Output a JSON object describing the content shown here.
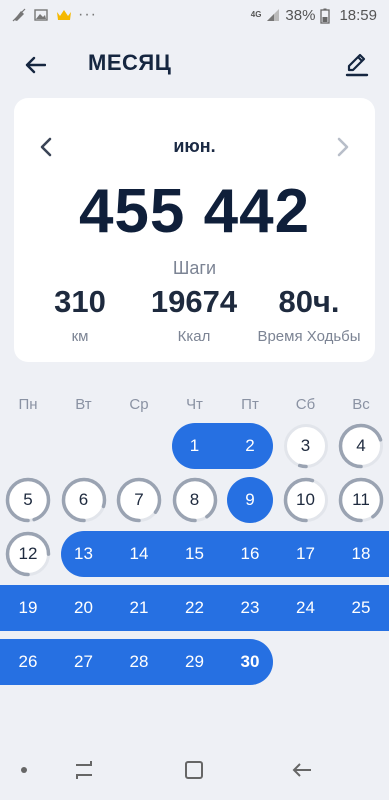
{
  "status_bar": {
    "network": "4G",
    "battery": "38%",
    "time": "18:59",
    "left_icons": [
      "mute-icon",
      "gallery-icon",
      "crown-icon",
      "more-dots-icon"
    ],
    "more": "···"
  },
  "header": {
    "title": "МЕСЯЦ",
    "back_icon": "arrow-left-icon",
    "edit_icon": "pencil-icon"
  },
  "summary": {
    "month": "июн.",
    "total_steps": "455 442",
    "steps_label": "Шаги",
    "distance_value": "310",
    "distance_label": "км",
    "calories_value": "19674",
    "calories_label": "Ккал",
    "walk_time_value": "80ч.",
    "walk_time_label": "Время Ходьбы"
  },
  "calendar": {
    "weekdays": [
      "Пн",
      "Вт",
      "Ср",
      "Чт",
      "Пт",
      "Сб",
      "Вс"
    ],
    "days": [
      {
        "d": "1",
        "goal": 1.0
      },
      {
        "d": "2",
        "goal": 1.0
      },
      {
        "d": "3",
        "goal": 0.05
      },
      {
        "d": "4",
        "goal": 0.7
      },
      {
        "d": "5",
        "goal": 0.95
      },
      {
        "d": "6",
        "goal": 0.8
      },
      {
        "d": "7",
        "goal": 0.85
      },
      {
        "d": "8",
        "goal": 0.9
      },
      {
        "d": "9",
        "goal": 1.0
      },
      {
        "d": "10",
        "goal": 0.55
      },
      {
        "d": "11",
        "goal": 0.9
      },
      {
        "d": "12",
        "goal": 0.75
      },
      {
        "d": "13",
        "goal": 1.0
      },
      {
        "d": "14",
        "goal": 1.0
      },
      {
        "d": "15",
        "goal": 1.0
      },
      {
        "d": "16",
        "goal": 1.0
      },
      {
        "d": "17",
        "goal": 1.0
      },
      {
        "d": "18",
        "goal": 1.0
      },
      {
        "d": "19",
        "goal": 1.0
      },
      {
        "d": "20",
        "goal": 1.0
      },
      {
        "d": "21",
        "goal": 1.0
      },
      {
        "d": "22",
        "goal": 1.0
      },
      {
        "d": "23",
        "goal": 1.0
      },
      {
        "d": "24",
        "goal": 1.0
      },
      {
        "d": "25",
        "goal": 1.0
      },
      {
        "d": "26",
        "goal": 1.0
      },
      {
        "d": "27",
        "goal": 1.0
      },
      {
        "d": "28",
        "goal": 1.0
      },
      {
        "d": "29",
        "goal": 1.0
      },
      {
        "d": "30",
        "goal": 1.0
      }
    ],
    "today": "30",
    "first_weekday_index": 3
  },
  "nav_bar": {
    "icons": [
      "dot-icon",
      "recent-apps-icon",
      "home-icon",
      "back-icon"
    ]
  },
  "colors": {
    "accent": "#2670e2",
    "ring": "#9aa3b2",
    "background": "#eef0f5",
    "card": "#ffffff"
  }
}
